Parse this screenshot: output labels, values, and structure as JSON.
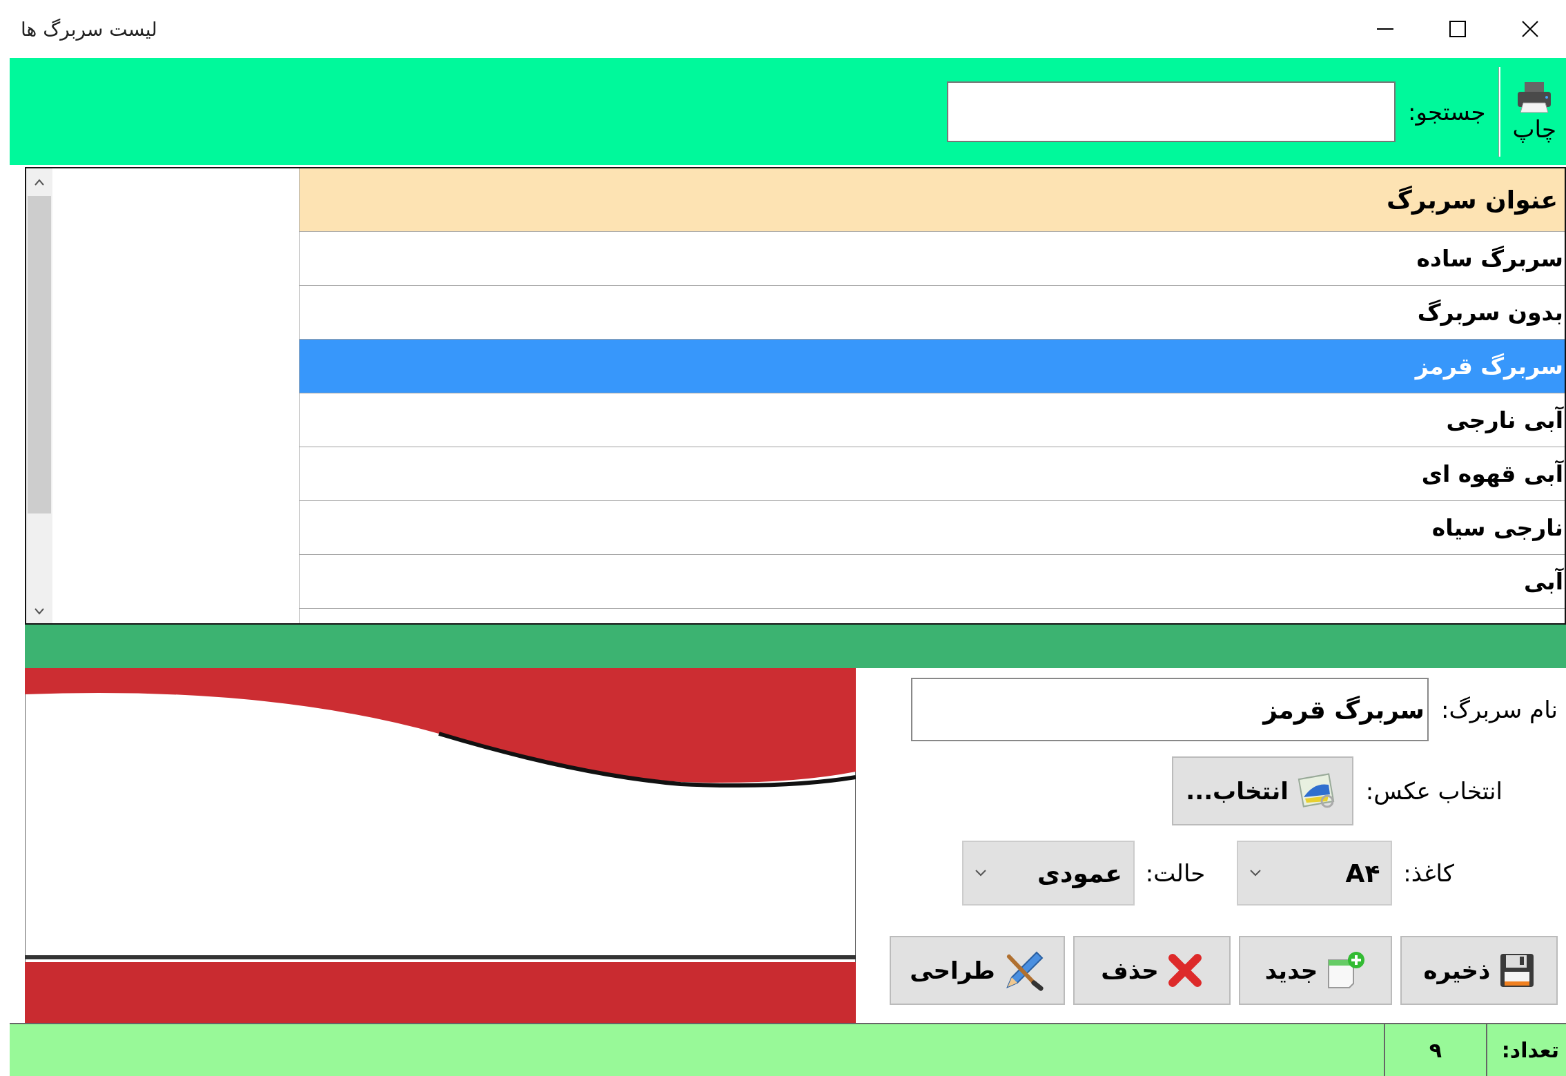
{
  "window": {
    "title": "لیست سربرگ ها"
  },
  "toolbar": {
    "print_button": "چاپ",
    "search": {
      "label": "جستجو:"
    }
  },
  "table": {
    "columns": [
      "عنوان سربرگ"
    ],
    "rows": [
      {
        "title": "سربرگ ساده",
        "selected": false
      },
      {
        "title": "بدون سربرگ",
        "selected": false
      },
      {
        "title": "سربرگ قرمز",
        "selected": true
      },
      {
        "title": "آبی نارجی",
        "selected": false
      },
      {
        "title": "آبی قهوه ای",
        "selected": false
      },
      {
        "title": "نارجی سیاه",
        "selected": false
      },
      {
        "title": "آبی",
        "selected": false
      }
    ]
  },
  "form": {
    "name": {
      "label": "نام سربرگ:",
      "value": "سربرگ قرمز"
    },
    "image": {
      "label": "انتخاب عکس:",
      "button": "انتخاب..."
    },
    "paper": {
      "label": "کاغذ:",
      "value": "A۴"
    },
    "orientation": {
      "label": "حالت:",
      "value": "عمودی"
    },
    "buttons": [
      {
        "kind": "save",
        "label": "ذخیره"
      },
      {
        "kind": "new",
        "label": "جدید"
      },
      {
        "kind": "delete",
        "label": "حذف"
      },
      {
        "kind": "design",
        "label": "طراحی"
      }
    ]
  },
  "status_bar": {
    "label": "تعداد:",
    "count": "۹"
  }
}
